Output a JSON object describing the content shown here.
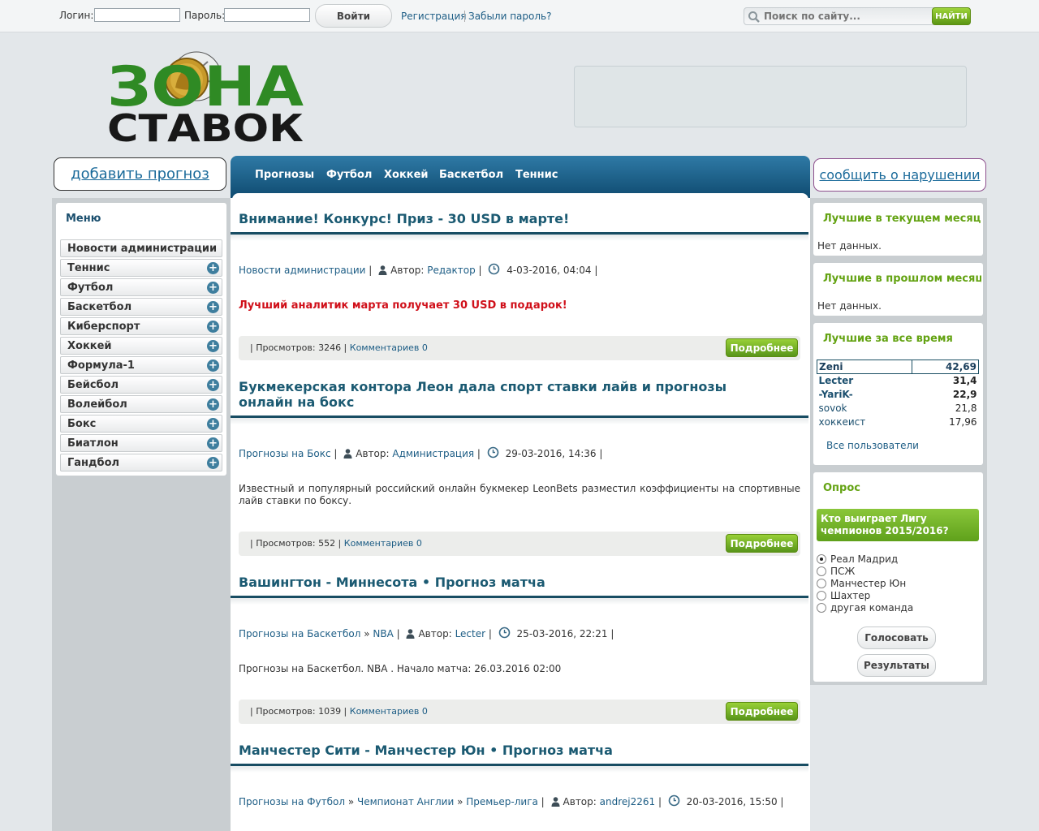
{
  "topbar": {
    "login_label": "Логин:",
    "password_label": "Пароль:",
    "login_button": "Войти",
    "register_link": "Регистрация",
    "forgot_link": "Забыли пароль?",
    "search_placeholder": "Поиск по сайту...",
    "search_button": "НАЙТИ"
  },
  "logo": {
    "line1": "ЗОНА",
    "line2": "СТАВОК"
  },
  "buttons": {
    "add_forecast": "добавить прогноз",
    "report_violation": "сообщить о нарушении"
  },
  "nav": [
    "Прогнозы",
    "Футбол",
    "Хоккей",
    "Баскетбол",
    "Теннис"
  ],
  "menu": {
    "title": "Меню",
    "items": [
      "Новости администрации",
      "Теннис",
      "Футбол",
      "Баскетбол",
      "Киберспорт",
      "Хоккей",
      "Формула-1",
      "Бейсбол",
      "Волейбол",
      "Бокс",
      "Биатлон",
      "Гандбол"
    ]
  },
  "posts": [
    {
      "title": "Внимание! Конкурс! Приз - 30 USD в марте!",
      "category": "Новости администрации",
      "author_label": "Автор:",
      "author": "Редактор",
      "date": "4-03-2016, 04:04",
      "body": "Лучший аналитик марта получает 30 USD в подарок!",
      "views": "| Просмотров: 3246 |",
      "comments": "Комментариев 0",
      "more": "Подробнее"
    },
    {
      "title": "Букмекерская контора Леон дала спорт ставки лайв и прогнозы онлайн на бокс",
      "category": "Прогнозы на Бокс",
      "author_label": "Автор:",
      "author": "Администрация",
      "date": "29-03-2016, 14:36",
      "body": "Известный и популярный российский онлайн букмекер LeonBets разместил коэффициенты на спортивные лайв ставки по боксу.",
      "views": "| Просмотров: 552 |",
      "comments": "Комментариев 0",
      "more": "Подробнее"
    },
    {
      "title": "Вашингтон - Миннесота • Прогноз матча",
      "category": "Прогнозы на Баскетбол",
      "subcategory": "NBA",
      "author_label": "Автор:",
      "author": "Lecter",
      "date": "25-03-2016, 22:21",
      "body": "Прогнозы на Баскетбол. NBA . Начало матча: 26.03.2016 02:00",
      "views": "| Просмотров: 1039 |",
      "comments": "Комментариев 0",
      "more": "Подробнее"
    },
    {
      "title": "Манчестер Сити - Манчестер Юн • Прогноз матча",
      "category": "Прогнозы на Футбол",
      "subcategory": "Чемпионат Англии",
      "subcategory2": "Премьер-лига",
      "author_label": "Автор:",
      "author": "andrej2261",
      "date": "20-03-2016, 15:50"
    }
  ],
  "right": {
    "best_month": "Лучшие в текущем месяце",
    "best_last_month": "Лучшие в прошлом месяце",
    "no_data": "Нет данных.",
    "best_all": "Лучшие за все время",
    "leaders": [
      {
        "name": "Zeni",
        "score": "42,69"
      },
      {
        "name": "Lecter",
        "score": "31,4"
      },
      {
        "name": "-YariK-",
        "score": "22,9"
      },
      {
        "name": "sovok",
        "score": "21,8"
      },
      {
        "name": "хоккеист",
        "score": "17,96"
      }
    ],
    "all_users": "Все пользователи",
    "poll_title": "Опрос",
    "poll_question": "Кто выиграет Лигу чемпионов 2015/2016?",
    "poll_options": [
      "Реал Мадрид",
      "ПСЖ",
      "Манчестер Юн",
      "Шахтер",
      "другая команда"
    ],
    "vote": "Голосовать",
    "results": "Результаты"
  },
  "colors": {
    "nav": "#15557d",
    "accent_green": "#64a313",
    "title": "#1b5a72",
    "alert_red": "#d0101a"
  }
}
